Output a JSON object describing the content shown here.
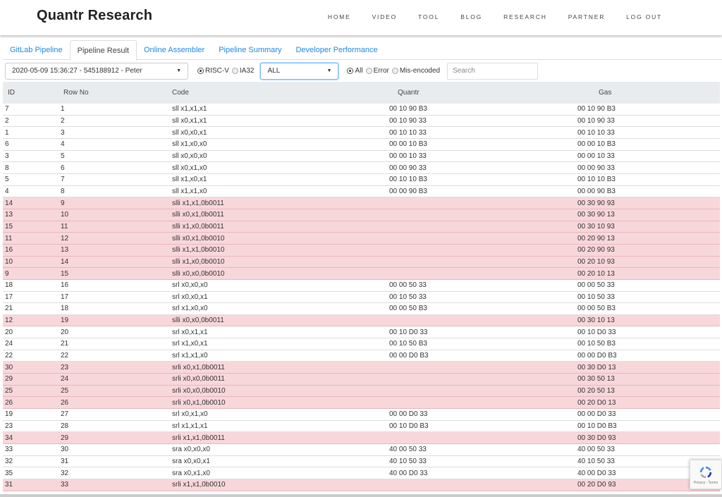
{
  "nav": {
    "brand": "Quantr Research",
    "items": [
      "HOME",
      "VIDEO",
      "TOOL",
      "BLOG",
      "RESEARCH",
      "PARTNER",
      "LOG OUT"
    ]
  },
  "tabs": [
    {
      "label": "GitLab Pipeline",
      "active": false
    },
    {
      "label": "Pipeline Result",
      "active": true
    },
    {
      "label": "Online Assembler",
      "active": false
    },
    {
      "label": "Pipeline Summary",
      "active": false
    },
    {
      "label": "Developer Performance",
      "active": false
    }
  ],
  "filters": {
    "pipeline": "2020-05-09 15:36:27 - 545188912 - Peter",
    "arch_options": [
      {
        "label": "RISC-V",
        "checked": true
      },
      {
        "label": "IA32",
        "checked": false
      }
    ],
    "type_select": "ALL",
    "result_options": [
      {
        "label": "All",
        "checked": true
      },
      {
        "label": "Error",
        "checked": false
      },
      {
        "label": "Mis-encoded",
        "checked": false
      }
    ],
    "search_placeholder": "Search"
  },
  "table": {
    "headers": [
      "ID",
      "Row No",
      "Code",
      "Quantr",
      "Gas"
    ],
    "rows": [
      {
        "id": "7",
        "row": "1",
        "code": "sll x1,x1,x1",
        "quantr": "00 10 90 B3",
        "gas": "00 10 90 B3",
        "err": false
      },
      {
        "id": "2",
        "row": "2",
        "code": "sll x0,x1,x1",
        "quantr": "00 10 90 33",
        "gas": "00 10 90 33",
        "err": false
      },
      {
        "id": "1",
        "row": "3",
        "code": "sll x0,x0,x1",
        "quantr": "00 10 10 33",
        "gas": "00 10 10 33",
        "err": false
      },
      {
        "id": "6",
        "row": "4",
        "code": "sll x1,x0,x0",
        "quantr": "00 00 10 B3",
        "gas": "00 00 10 B3",
        "err": false
      },
      {
        "id": "3",
        "row": "5",
        "code": "sll x0,x0,x0",
        "quantr": "00 00 10 33",
        "gas": "00 00 10 33",
        "err": false
      },
      {
        "id": "8",
        "row": "6",
        "code": "sll x0,x1,x0",
        "quantr": "00 00 90 33",
        "gas": "00 00 90 33",
        "err": false
      },
      {
        "id": "5",
        "row": "7",
        "code": "sll x1,x0,x1",
        "quantr": "00 10 10 B3",
        "gas": "00 10 10 B3",
        "err": false
      },
      {
        "id": "4",
        "row": "8",
        "code": "sll x1,x1,x0",
        "quantr": "00 00 90 B3",
        "gas": "00 00 90 B3",
        "err": false
      },
      {
        "id": "14",
        "row": "9",
        "code": "slli x1,x1,0b0011",
        "quantr": "",
        "gas": "00 30 90 93",
        "err": true
      },
      {
        "id": "13",
        "row": "10",
        "code": "slli x0,x1,0b0011",
        "quantr": "",
        "gas": "00 30 90 13",
        "err": true
      },
      {
        "id": "15",
        "row": "11",
        "code": "slli x1,x0,0b0011",
        "quantr": "",
        "gas": "00 30 10 93",
        "err": true
      },
      {
        "id": "11",
        "row": "12",
        "code": "slli x0,x1,0b0010",
        "quantr": "",
        "gas": "00 20 90 13",
        "err": true
      },
      {
        "id": "16",
        "row": "13",
        "code": "slli x1,x1,0b0010",
        "quantr": "",
        "gas": "00 20 90 93",
        "err": true
      },
      {
        "id": "10",
        "row": "14",
        "code": "slli x1,x0,0b0010",
        "quantr": "",
        "gas": "00 20 10 93",
        "err": true
      },
      {
        "id": "9",
        "row": "15",
        "code": "slli x0,x0,0b0010",
        "quantr": "",
        "gas": "00 20 10 13",
        "err": true
      },
      {
        "id": "18",
        "row": "16",
        "code": "srl x0,x0,x0",
        "quantr": "00 00 50 33",
        "gas": "00 00 50 33",
        "err": false
      },
      {
        "id": "17",
        "row": "17",
        "code": "srl x0,x0,x1",
        "quantr": "00 10 50 33",
        "gas": "00 10 50 33",
        "err": false
      },
      {
        "id": "21",
        "row": "18",
        "code": "srl x1,x0,x0",
        "quantr": "00 00 50 B3",
        "gas": "00 00 50 B3",
        "err": false
      },
      {
        "id": "12",
        "row": "19",
        "code": "slli x0,x0,0b0011",
        "quantr": "",
        "gas": "00 30 10 13",
        "err": true
      },
      {
        "id": "20",
        "row": "20",
        "code": "srl x0,x1,x1",
        "quantr": "00 10 D0 33",
        "gas": "00 10 D0 33",
        "err": false
      },
      {
        "id": "24",
        "row": "21",
        "code": "srl x1,x0,x1",
        "quantr": "00 10 50 B3",
        "gas": "00 10 50 B3",
        "err": false
      },
      {
        "id": "22",
        "row": "22",
        "code": "srl x1,x1,x0",
        "quantr": "00 00 D0 B3",
        "gas": "00 00 D0 B3",
        "err": false
      },
      {
        "id": "30",
        "row": "23",
        "code": "srli x0,x1,0b0011",
        "quantr": "",
        "gas": "00 30 D0 13",
        "err": true
      },
      {
        "id": "29",
        "row": "24",
        "code": "srli x0,x0,0b0011",
        "quantr": "",
        "gas": "00 30 50 13",
        "err": true
      },
      {
        "id": "25",
        "row": "25",
        "code": "srli x0,x0,0b0010",
        "quantr": "",
        "gas": "00 20 50 13",
        "err": true
      },
      {
        "id": "26",
        "row": "26",
        "code": "srli x0,x1,0b0010",
        "quantr": "",
        "gas": "00 20 D0 13",
        "err": true
      },
      {
        "id": "19",
        "row": "27",
        "code": "srl x0,x1,x0",
        "quantr": "00 00 D0 33",
        "gas": "00 00 D0 33",
        "err": false
      },
      {
        "id": "23",
        "row": "28",
        "code": "srl x1,x1,x1",
        "quantr": "00 10 D0 B3",
        "gas": "00 10 D0 B3",
        "err": false
      },
      {
        "id": "34",
        "row": "29",
        "code": "srli x1,x1,0b0011",
        "quantr": "",
        "gas": "00 30 D0 93",
        "err": true
      },
      {
        "id": "33",
        "row": "30",
        "code": "sra x0,x0,x0",
        "quantr": "40 00 50 33",
        "gas": "40 00 50 33",
        "err": false
      },
      {
        "id": "32",
        "row": "31",
        "code": "sra x0,x0,x1",
        "quantr": "40 10 50 33",
        "gas": "40 10 50 33",
        "err": false
      },
      {
        "id": "35",
        "row": "32",
        "code": "sra x0,x1,x0",
        "quantr": "40 00 D0 33",
        "gas": "40 00 D0 33",
        "err": false
      },
      {
        "id": "31",
        "row": "33",
        "code": "srli x1,x1,0b0010",
        "quantr": "",
        "gas": "00 20 D0 93",
        "err": true
      }
    ]
  },
  "recaptcha": {
    "text": "Privacy - Terms"
  }
}
